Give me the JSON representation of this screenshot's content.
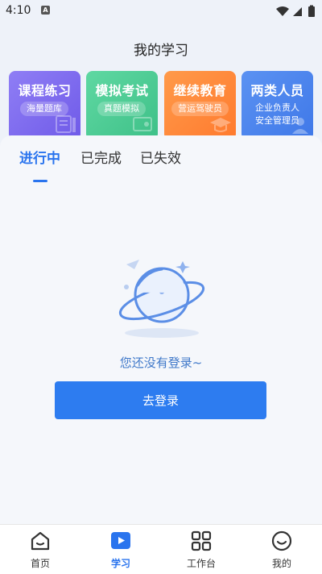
{
  "status_bar": {
    "time": "4:10",
    "notification_badge": "A"
  },
  "header": {
    "title": "我的学习"
  },
  "cards": [
    {
      "title": "课程练习",
      "subtitle": "海量题库",
      "color": "#7f6df2"
    },
    {
      "title": "模拟考试",
      "subtitle": "真题模拟",
      "color": "#4fcc95"
    },
    {
      "title": "继续教育",
      "subtitle": "营运驾驶员",
      "color": "#ff8a3d"
    },
    {
      "title": "两类人员",
      "subtitle_line1": "企业负责人",
      "subtitle_line2": "安全管理员",
      "color": "#4f86ee"
    }
  ],
  "tabs": [
    {
      "label": "进行中",
      "active": true
    },
    {
      "label": "已完成",
      "active": false
    },
    {
      "label": "已失效",
      "active": false
    }
  ],
  "empty_state": {
    "message": "您还没有登录~",
    "button_label": "去登录"
  },
  "bottom_nav": [
    {
      "label": "首页",
      "icon": "home-icon",
      "active": false
    },
    {
      "label": "学习",
      "icon": "play-icon",
      "active": true
    },
    {
      "label": "工作台",
      "icon": "grid-icon",
      "active": false
    },
    {
      "label": "我的",
      "icon": "smile-icon",
      "active": false
    }
  ],
  "colors": {
    "accent": "#2a74ee",
    "button": "#2d7cf0",
    "background": "#eef2f9"
  }
}
